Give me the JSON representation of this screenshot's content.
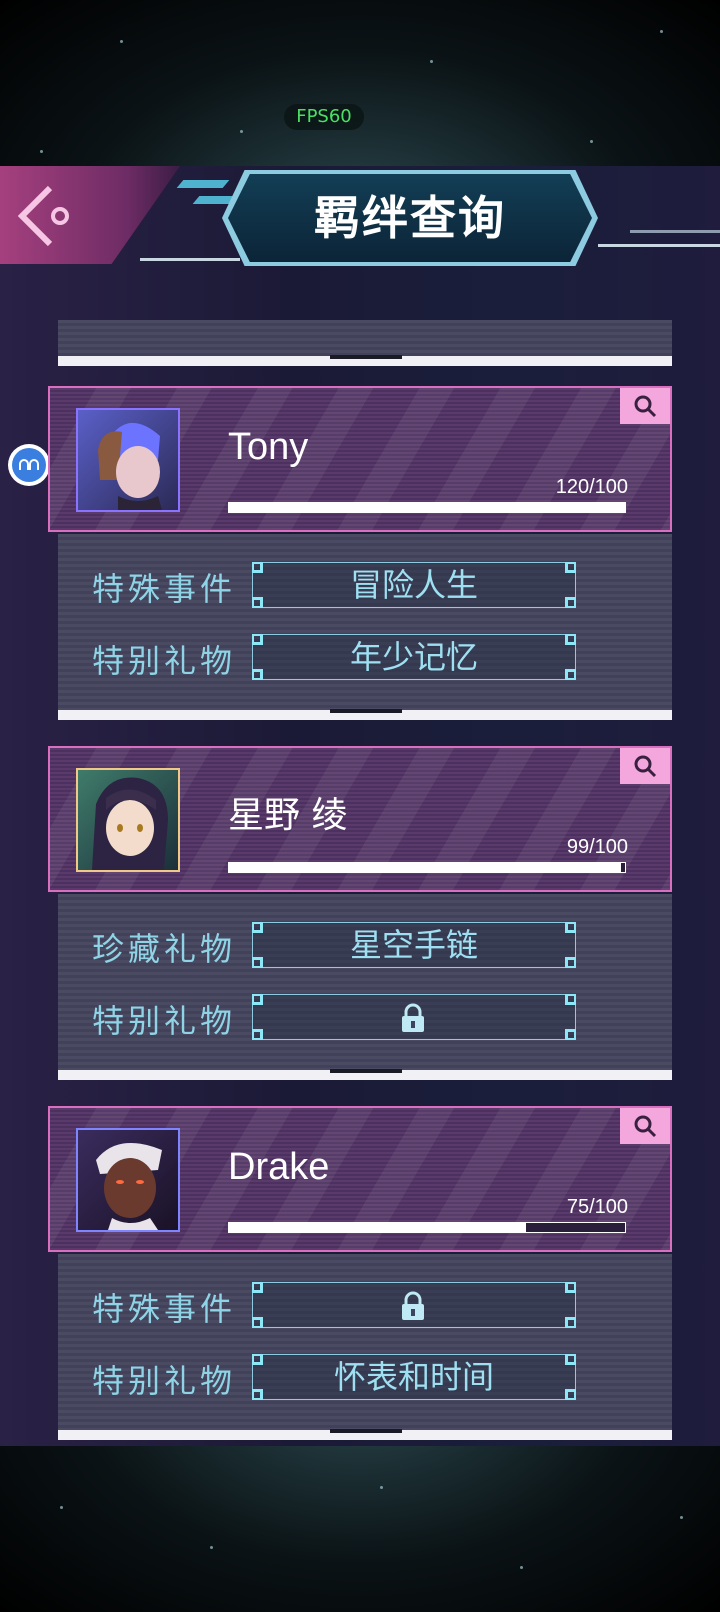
{
  "status": {
    "fps": "FPS60"
  },
  "header": {
    "title": "羁绊查询"
  },
  "cards": [
    {
      "name": "Tony",
      "score": "120/100",
      "progress": 1.0,
      "rows": [
        {
          "label": "特殊事件",
          "value": "冒险人生",
          "locked": false
        },
        {
          "label": "特别礼物",
          "value": "年少记忆",
          "locked": false
        }
      ]
    },
    {
      "name": "星野 绫",
      "score": "99/100",
      "progress": 0.99,
      "rows": [
        {
          "label": "珍藏礼物",
          "value": "星空手链",
          "locked": false
        },
        {
          "label": "特别礼物",
          "value": "",
          "locked": true
        }
      ]
    },
    {
      "name": "Drake",
      "score": "75/100",
      "progress": 0.75,
      "rows": [
        {
          "label": "特殊事件",
          "value": "",
          "locked": true
        },
        {
          "label": "特别礼物",
          "value": "怀表和时间",
          "locked": false
        }
      ]
    }
  ],
  "icons": {
    "back": "back-chevron-icon",
    "search": "magnifier-icon",
    "lock": "padlock-icon",
    "assistant": "floating-assistant-icon"
  },
  "colors": {
    "accent_pink": "#d86fbf",
    "label_cyan": "#8fd4e6",
    "fps_green": "#4be064"
  }
}
